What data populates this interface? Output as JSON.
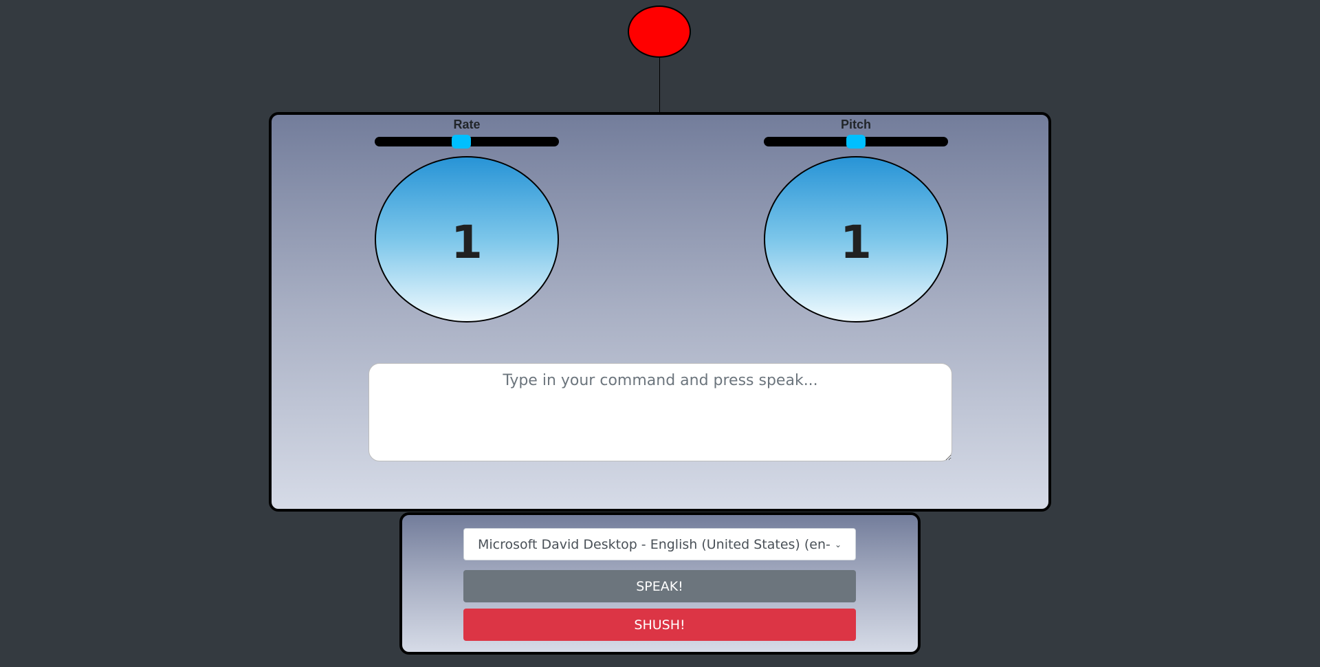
{
  "rate": {
    "label": "Rate",
    "value": "1",
    "slider_fraction": 0.47
  },
  "pitch": {
    "label": "Pitch",
    "value": "1",
    "slider_fraction": 0.5
  },
  "command": {
    "placeholder": "Type in your command and press speak..."
  },
  "voice": {
    "selected": "Microsoft David Desktop - English (United States) (en-US)"
  },
  "buttons": {
    "speak": "SPEAK!",
    "shush": "SHUSH!"
  },
  "colors": {
    "background": "#343a40",
    "antenna": "#ff0000",
    "slider_thumb": "#00bfff",
    "speak_button": "#6c757d",
    "shush_button": "#dc3545"
  },
  "icons": {
    "select_caret": "chevron-down-icon"
  }
}
